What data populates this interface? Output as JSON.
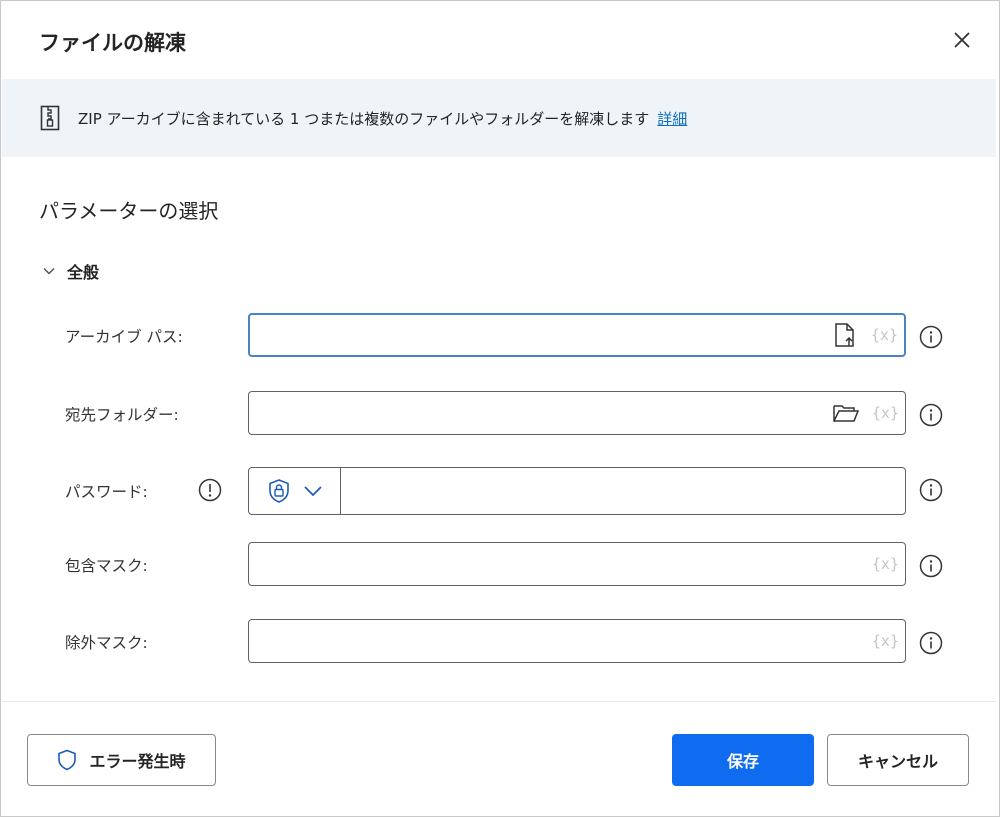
{
  "dialog": {
    "title": "ファイルの解凍"
  },
  "banner": {
    "description": "ZIP アーカイブに含まれている 1 つまたは複数のファイルやフォルダーを解凍します",
    "link": "詳細"
  },
  "section": {
    "title": "パラメーターの選択",
    "group_label": "全般"
  },
  "fields": {
    "archive_path": {
      "label": "アーカイブ パス:",
      "value": "",
      "var_icon": "{x}"
    },
    "destination_folder": {
      "label": "宛先フォルダー:",
      "value": "",
      "var_icon": "{x}"
    },
    "password": {
      "label": "パスワード:",
      "value": ""
    },
    "include_mask": {
      "label": "包含マスク:",
      "value": "",
      "var_icon": "{x}"
    },
    "exclude_mask": {
      "label": "除外マスク:",
      "value": "",
      "var_icon": "{x}"
    }
  },
  "footer": {
    "on_error_label": "エラー発生時",
    "save_label": "保存",
    "cancel_label": "キャンセル"
  },
  "colors": {
    "primary": "#0f6cf0",
    "link": "#0f6cbd",
    "banner_bg": "#eff4f9",
    "focus_border": "#4a84c4"
  }
}
